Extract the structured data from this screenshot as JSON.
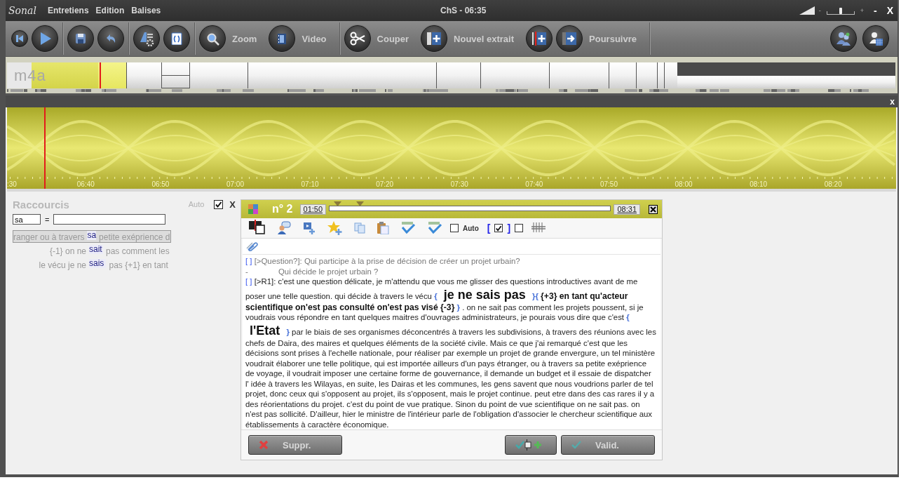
{
  "window": {
    "logo": "Sonal",
    "menu": [
      {
        "label": "Entretiens"
      },
      {
        "label": "Edition"
      },
      {
        "label": "Balises"
      }
    ],
    "title": "ChS - 06:35",
    "volume": {
      "minus": "-",
      "plus": "+",
      "level": 0.5
    },
    "minimize": "-",
    "close": "X"
  },
  "toolbar": {
    "groups": [
      {
        "items": [
          {
            "kind": "small"
          },
          {
            "kind": "round"
          }
        ]
      },
      {
        "items": [
          {
            "kind": "round"
          },
          {
            "kind": "round"
          }
        ]
      },
      {
        "items": [
          {
            "kind": "round"
          },
          {
            "kind": "round"
          }
        ]
      },
      {
        "items": [
          {
            "kind": "round",
            "label": "Zoom"
          },
          {
            "kind": "round",
            "label": "Video"
          }
        ]
      },
      {
        "items": [
          {
            "kind": "round",
            "label": "Couper"
          },
          {
            "kind": "round",
            "label": "Nouvel extrait"
          },
          {
            "kind": "round"
          },
          {
            "kind": "round",
            "label": "Poursuivre"
          }
        ]
      },
      {
        "items": [
          {
            "kind": "round"
          },
          {
            "kind": "round"
          }
        ]
      }
    ]
  },
  "timeline": {
    "label": "m4a"
  },
  "waveform": {
    "close": "x",
    "ticks": [
      ":30",
      "06:40",
      "06:50",
      "07:00",
      "07:10",
      "07:20",
      "07:30",
      "07:40",
      "07:50",
      "08:00",
      "08:10",
      "08:20"
    ]
  },
  "shortcuts": {
    "title": "Raccourcis",
    "auto": {
      "label": "Auto",
      "checked": true
    },
    "close": "X",
    "search": {
      "value": "sa"
    },
    "equals": "=",
    "results": [
      {
        "before": "ranger ou à travers",
        "match": "sa",
        "after": "petite exéprience d",
        "selected": true
      },
      {
        "before": "{-1}  on ne",
        "match": "sait",
        "after": "pas comment les",
        "selected": false
      },
      {
        "before": "le vécu  je ne",
        "match": "sais",
        "after": "pas {+1}  en tant",
        "selected": false
      }
    ]
  },
  "extract": {
    "number": "n° 2",
    "start": "01:50",
    "end": "08:31",
    "markers": [
      {
        "level": 0.03
      },
      {
        "level": 0.11
      }
    ],
    "tools": [
      {
        "kind": "icon"
      },
      {
        "kind": "icon"
      },
      {
        "kind": "icon"
      },
      {
        "kind": "icon"
      },
      {
        "kind": "icon"
      },
      {
        "kind": "icon"
      },
      {
        "kind": "icon"
      },
      {
        "kind": "icon"
      },
      {
        "kind": "checkbox",
        "label": "Auto",
        "checked": false
      },
      {
        "kind": "bracket-checkbox",
        "open": "[",
        "close": "]",
        "checked": true
      },
      {
        "kind": "checkbox",
        "checked": false
      },
      {
        "kind": "icon"
      }
    ],
    "paragraphs": [
      {
        "kind": "question",
        "runs": [
          {
            "kind": "mark",
            "text": "[ ]"
          },
          {
            "kind": "plain",
            "text": "[>Question?]: Qui participe à la prise de décision de créer un projet urbain?"
          }
        ]
      },
      {
        "kind": "question",
        "runs": [
          {
            "kind": "plain",
            "text": "-"
          },
          {
            "kind": "indent",
            "text": "Qui décide le projet urbain ?"
          }
        ]
      },
      {
        "kind": "answer",
        "runs": [
          {
            "kind": "mark",
            "text": "[ ]"
          },
          {
            "kind": "plain",
            "text": "[>R1]: c'est une question délicate, je m'attendu que vous me glisser des questions introductives avant de me poser une telle question. qui décide à travers le vécu"
          },
          {
            "kind": "brace",
            "text": "{"
          },
          {
            "kind": "big",
            "text": "je ne sais pas"
          },
          {
            "kind": "brace",
            "text": "}{"
          },
          {
            "kind": "bold",
            "text": "{+3}  en tant qu'acteur scientifique on'est pas consulté on'est pas visé {-3}"
          },
          {
            "kind": "brace",
            "text": "}"
          },
          {
            "kind": "plain",
            "text": ". on ne sait pas comment les projets poussent, si je voudrais vous répondre en tant quelques maitres d'ouvrages administrateurs, je pourais vous dire que c'est"
          },
          {
            "kind": "brace",
            "text": "{"
          },
          {
            "kind": "big",
            "text": "l'Etat"
          },
          {
            "kind": "brace",
            "text": "}"
          },
          {
            "kind": "plain",
            "text": "par le biais de ses organismes déconcentrés à travers les subdivisions, à travers des réunions avec les chefs de Daira, des maires et quelques éléments de la société civile. Mais ce que j'ai remarqué c'est que les décisions sont prises à l'echelle nationale, pour réaliser par exemple un projet de grande envergure, un tel ministère voudrait élaborer une telle politique, qui est importée ailleurs d'un pays étranger, ou à travers sa petite exéprience de voyage, il voudrait imposer une certaine forme de gouvernance, il demande un budget et il essaie de dispatcher l' idée à travers les Wilayas, en suite, les Dairas et les communes, les gens savent que nous voudrions parler de tel projet, donc ceux qui s'opposent au projet, ils s'opposent, mais le projet continue. peut etre dans des cas rares il y a des réorientations du projet. c'est du point de vue pratique. Sinon du point de vue scientifique on ne sait pas. on n'est pas sollicité. D'ailleur, hier le ministre de l'intérieur parle de l'obligation d'associer le chercheur scientifique aux établissements à caractère économique."
          }
        ]
      }
    ],
    "buttons": [
      {
        "kind": "delete",
        "label": "Suppr."
      },
      {
        "kind": "split"
      },
      {
        "kind": "validate",
        "label": "Valid."
      }
    ]
  }
}
